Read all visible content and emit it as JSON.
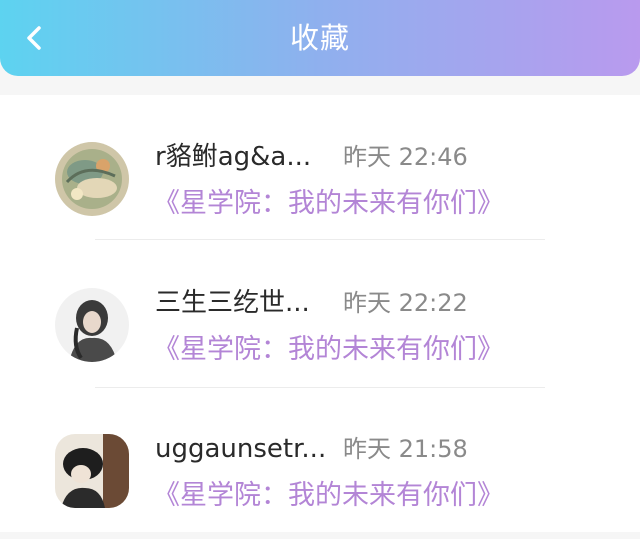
{
  "header": {
    "title": "收藏",
    "back_icon": "chevron-left-icon"
  },
  "colors": {
    "header_gradient_start": "#5dd3f0",
    "header_gradient_end": "#b99aee",
    "link": "#b385d6",
    "time": "#8a8a8a"
  },
  "favorites": [
    {
      "name": "r貉鲋ag&a...",
      "time": "昨天 22:46",
      "title": "《星学院：我的未来有你们》"
    },
    {
      "name": "三生三纥世...",
      "time": "昨天 22:22",
      "title": "《星学院：我的未来有你们》"
    },
    {
      "name": "uggaunsetr...",
      "time": "昨天 21:58",
      "title": "《星学院：我的未来有你们》"
    }
  ]
}
